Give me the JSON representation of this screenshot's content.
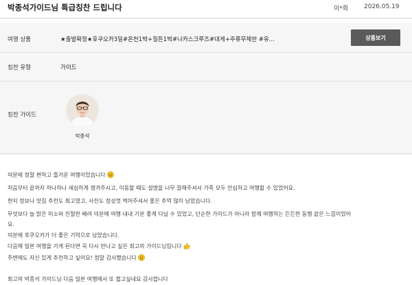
{
  "header": {
    "title": "박종석가이드님 특급칭찬 드립니다",
    "author": "이*희",
    "date": "2026.05.19"
  },
  "info": {
    "product_label": "여행 상품",
    "product_value": "★출발확정★후쿠오카3일#온천1박+힐튼1박#나카스크루즈#대게+주류무제한 #유...",
    "product_button": "상품보기",
    "type_label": "칭찬 유형",
    "type_value": "가이드",
    "guide_label": "칭찬 가이드",
    "guide_name": "박종석"
  },
  "review": {
    "lines": [
      "덕분에 정말 편하고 즐거운 여행이었습니다",
      "처음부터 끝까지 하나하나 세심하게 챙겨주시고, 이동할 때도 설명을 너무 잘해주셔서 가족 모두 안심하고 여행할 수 있었어요.",
      "현지 정보나 맛집 추천도 최고였고, 사진도 정성껏 찍어주셔서 좋은 추억 많이 남았습니다.",
      "무엇보다 늘 밝은 미소와 친절한 배려 덕분에 여행 내내 기분 좋게 다닐 수 있었고, 단순한 가이드가 아니라 함께 여행하는 든든한 동행 같은 느낌이었어",
      "요.",
      "덕분에 후쿠오카가 더 좋은 기억으로 남았습니다.",
      "다음에 일본 여행을 가게 된다면 꼭 다시 만나고 싶은 최고의 가이드님입니다",
      "주변에도 자신 있게 추천하고 싶어요! 정말 감사했습니다",
      "최고의 박종석 가이드님 다음 일본 여행에서 또 뵙고싶네요 감사합니다"
    ]
  },
  "icons": {
    "smile": "smiling-face-icon",
    "thumbs": "thumbs-up-icon",
    "emoji_color": "#f6c223"
  }
}
